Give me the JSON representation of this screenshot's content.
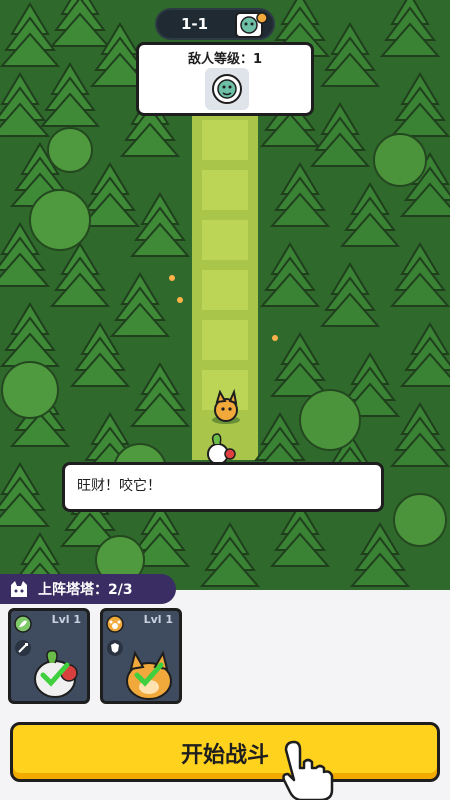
{
  "level": {
    "label": "1-1"
  },
  "enemy_panel": {
    "title": "敌人等级：1"
  },
  "dialog": {
    "text": "旺财！咬它！"
  },
  "squad": {
    "label": "上阵塔塔：2/3"
  },
  "cards": [
    {
      "level": "Lvl 1"
    },
    {
      "level": "Lvl 1"
    }
  ],
  "start_button": {
    "label": "开始战斗"
  }
}
